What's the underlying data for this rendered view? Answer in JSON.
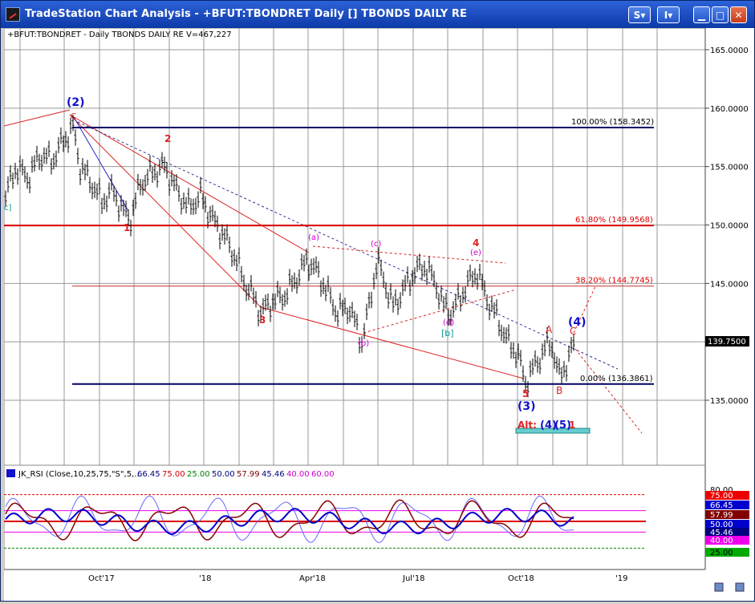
{
  "window": {
    "title": "TradeStation Chart Analysis - +BFUT:TBONDRET Daily [] TBONDS DAILY RE",
    "btn_s": "S",
    "btn_i": "I"
  },
  "price_pane": {
    "header": "+BFUT:TBONDRET - Daily  TBONDS DAILY RE  V=467,227",
    "last_price": "139.7500",
    "y_ticks": [
      "165.0000",
      "160.0000",
      "155.0000",
      "150.0000",
      "145.0000",
      "140.0000",
      "135.0000"
    ],
    "fib_levels": [
      {
        "label": "100.00% (158.3452)",
        "value": 158.3452
      },
      {
        "label": "61.80% (149.9568)",
        "value": 149.9568
      },
      {
        "label": "38.20% (144.7745)",
        "value": 144.7745
      },
      {
        "label": "0.00% (136.3861)",
        "value": 136.3861
      }
    ],
    "wave_labels": {
      "w2": "(2)",
      "c_top": "C",
      "n2": "2",
      "n1": "1",
      "n3": "3",
      "a_lbl": "(a)",
      "b_lbl": "(b)",
      "c_lbl": "(c)",
      "d_lbl": "(d)",
      "e_lbl": "(e)",
      "n4": "4",
      "bb": "[b]",
      "n5": "5",
      "w3": "(3)",
      "A": "A",
      "B": "B",
      "C": "C",
      "w4": "(4)",
      "alt": "Alt:",
      "alt_w4": "(4)",
      "alt_w5": "(5)",
      "alt_1": "1",
      "cc": "c]"
    }
  },
  "rsi_pane": {
    "header": "JK_RSI (Close,10,25,75,\"S\",5,...",
    "values": [
      {
        "text": "66.45",
        "color": "#000080"
      },
      {
        "text": "75.00",
        "color": "#cc0000"
      },
      {
        "text": "25.00",
        "color": "#008000"
      },
      {
        "text": "50.00",
        "color": "#000080"
      },
      {
        "text": "57.99",
        "color": "#800000"
      },
      {
        "text": "45.46",
        "color": "#000080"
      },
      {
        "text": "40.00",
        "color": "#cc00cc"
      },
      {
        "text": "60.00",
        "color": "#cc00cc"
      }
    ],
    "y_ticks": [
      "80.00",
      "20.00"
    ],
    "badges": [
      {
        "text": "75.00",
        "color": "#ee0000"
      },
      {
        "text": "66.45",
        "color": "#0000cc"
      },
      {
        "text": "57.99",
        "color": "#800000"
      },
      {
        "text": "50.00",
        "color": "#0000cc"
      },
      {
        "text": "45.46",
        "color": "#000080"
      },
      {
        "text": "40.00",
        "color": "#ee00ee"
      },
      {
        "text": "25.00",
        "color": "#00aa00"
      }
    ]
  },
  "x_axis": {
    "labels": [
      "Oct'17",
      "'18",
      "Apr'18",
      "Jul'18",
      "Oct'18",
      "'19"
    ]
  }
}
